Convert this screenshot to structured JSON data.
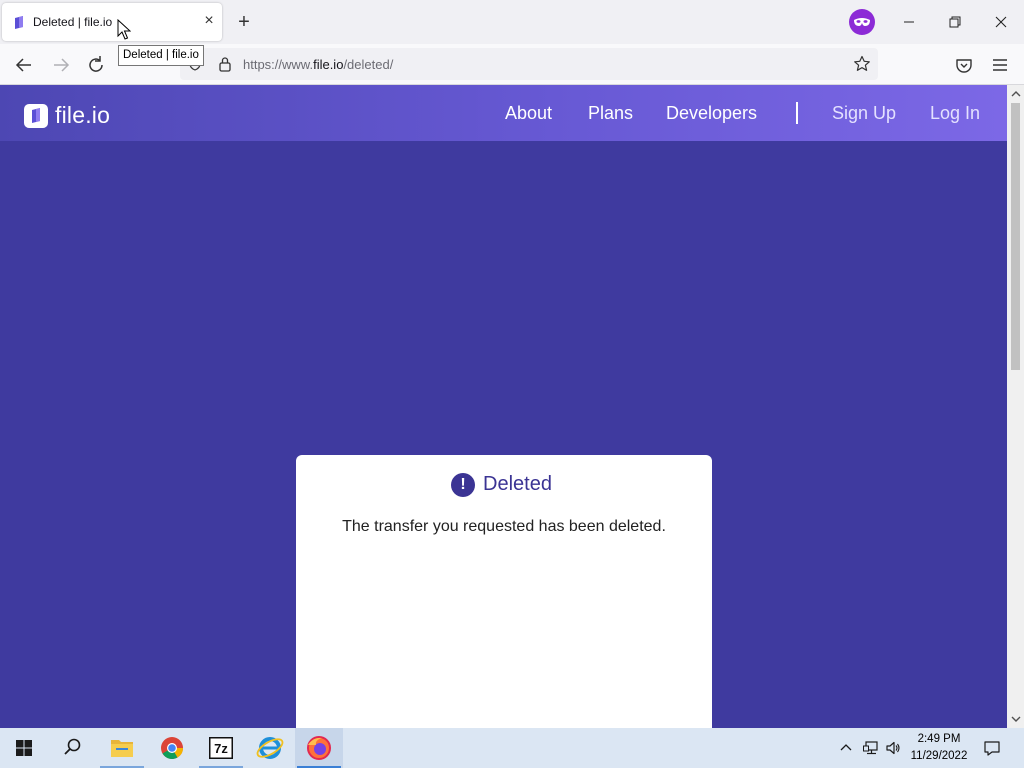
{
  "browser": {
    "tab": {
      "title": "Deleted | file.io",
      "close_glyph": "×"
    },
    "new_tab_glyph": "+",
    "tooltip": "Deleted | file.io",
    "url": {
      "prefix": "https://www.",
      "domain": "file.io",
      "path": "/deleted/"
    }
  },
  "site": {
    "logo_text": "file.io",
    "nav": {
      "about": "About",
      "plans": "Plans",
      "developers": "Developers",
      "signup": "Sign Up",
      "login": "Log In"
    },
    "card": {
      "icon_glyph": "!",
      "title": "Deleted",
      "message": "The transfer you requested has been deleted."
    }
  },
  "taskbar": {
    "time": "2:49 PM",
    "date": "11/29/2022",
    "items": [
      "start-icon",
      "search-icon",
      "file-explorer-icon",
      "chrome-icon",
      "7zip-icon",
      "internet-explorer-icon",
      "firefox-icon"
    ],
    "sevenzip_label": "7z"
  },
  "colors": {
    "page_bg": "#3f3a9f",
    "header_gradient_start": "#4d47b3",
    "header_gradient_end": "#7c68e6",
    "accent": "#3b3494"
  }
}
